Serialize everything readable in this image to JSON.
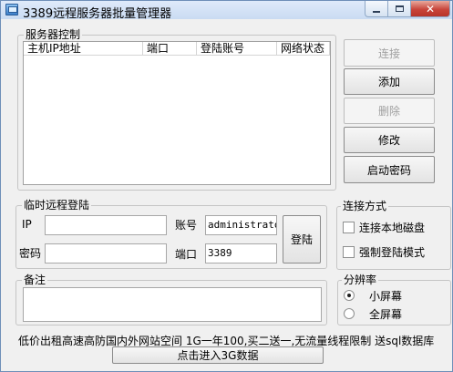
{
  "window": {
    "title": "3389远程服务器批量管理器",
    "minimize_icon": "minimize-icon",
    "maximize_icon": "maximize-icon",
    "close_icon": "close-icon"
  },
  "server_control": {
    "legend": "服务器控制",
    "columns": [
      "主机IP地址",
      "端口",
      "登陆账号",
      "网络状态"
    ],
    "rows": [],
    "buttons": {
      "connect": "连接",
      "add": "添加",
      "delete": "删除",
      "modify": "修改",
      "start_password": "启动密码"
    }
  },
  "temp_login": {
    "legend": "临时远程登陆",
    "ip_label": "IP",
    "ip_value": "",
    "account_label": "账号",
    "account_value": "administrator",
    "password_label": "密码",
    "password_value": "",
    "port_label": "端口",
    "port_value": "3389",
    "login_button": "登陆"
  },
  "connect_mode": {
    "legend": "连接方式",
    "option_local_disk": "连接本地磁盘",
    "option_local_disk_checked": false,
    "option_force_login": "强制登陆模式",
    "option_force_login_checked": false
  },
  "notes": {
    "legend": "备注",
    "value": ""
  },
  "resolution": {
    "legend": "分辨率",
    "option_small": "小屏幕",
    "option_full": "全屏幕",
    "selected": "small"
  },
  "footer": {
    "ad_text": "低价出租高速高防国内外网站空间 1G一年100,买二送一,无流量线程限制 送sql数据库",
    "enter_button": "点击进入3G数据"
  },
  "colors": {
    "title_bar": "#dfeafa",
    "close_button": "#c8453b",
    "face": "#f0f0f0"
  }
}
